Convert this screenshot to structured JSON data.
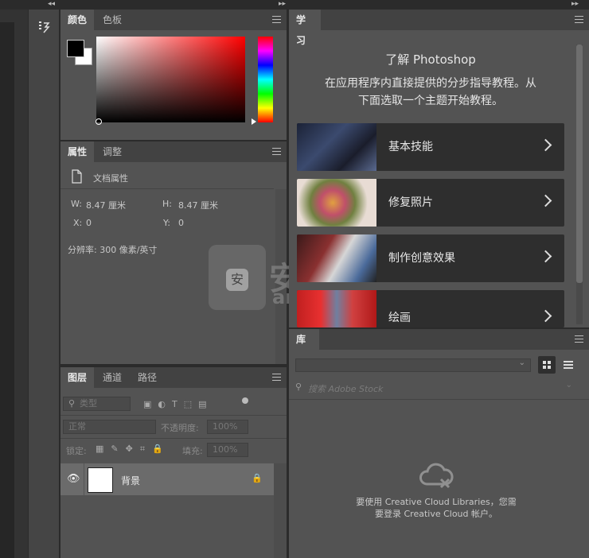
{
  "top_arrows": {
    "left": "◂◂",
    "middle": "▸▸",
    "right": "▸▸"
  },
  "color_panel": {
    "tabs": [
      "颜色",
      "色板"
    ]
  },
  "properties_panel": {
    "tabs": [
      "属性",
      "调整"
    ],
    "doc_label": "文档属性",
    "w_label": "W:",
    "w_value": "8.47 厘米",
    "h_label": "H:",
    "h_value": "8.47 厘米",
    "x_label": "X:",
    "x_value": "0",
    "y_label": "Y:",
    "y_value": "0",
    "resolution": "分辨率: 300 像素/英寸"
  },
  "layers_panel": {
    "tabs": [
      "图层",
      "通道",
      "路径"
    ],
    "filter_placeholder": "类型",
    "blend_mode": "正常",
    "opacity_label": "不透明度:",
    "opacity_value": "100%",
    "lock_label": "锁定:",
    "fill_label": "填充:",
    "fill_value": "100%",
    "layers": [
      {
        "name": "背景",
        "visible": true,
        "locked": true
      }
    ]
  },
  "learn_panel": {
    "tab": "学习",
    "title": "了解 Photoshop",
    "desc_line1": "在应用程序内直接提供的分步指导教程。从",
    "desc_line2": "下面选取一个主题开始教程。",
    "topics": [
      {
        "label": "基本技能"
      },
      {
        "label": "修复照片"
      },
      {
        "label": "制作创意效果"
      },
      {
        "label": "绘画"
      }
    ]
  },
  "library_panel": {
    "tab": "库",
    "search_placeholder": "搜索 Adobe Stock",
    "msg_line1": "要使用 Creative Cloud Libraries，您需",
    "msg_line2": "要登录 Creative Cloud 帐户。"
  },
  "watermark": {
    "text": "安下载",
    "sub": "anxz.com"
  },
  "colors": {
    "panel": "#535353",
    "header": "#424242",
    "card": "#2e2e2e",
    "accent_red": "#ff0000"
  }
}
